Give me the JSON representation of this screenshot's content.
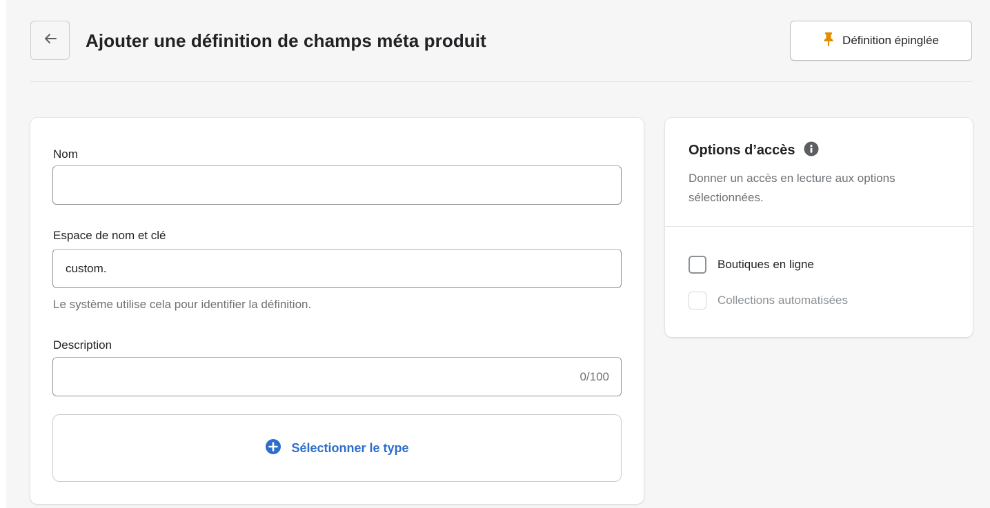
{
  "header": {
    "back_icon": "arrow-left-icon",
    "title": "Ajouter une définition de champs méta produit",
    "pin_button": {
      "label": "Définition épinglée",
      "icon": "pin-icon",
      "icon_color": "#e28d00"
    }
  },
  "form": {
    "name": {
      "label": "Nom",
      "value": "",
      "placeholder": ""
    },
    "namespace": {
      "label": "Espace de nom et clé",
      "value": "custom.",
      "help": "Le système utilise cela pour identifier la définition."
    },
    "description": {
      "label": "Description",
      "value": "",
      "counter": "0/100"
    },
    "select_type": {
      "label": "Sélectionner le type",
      "icon": "plus-circle-icon",
      "color": "#2c6ecb"
    }
  },
  "access": {
    "title": "Options d’accès",
    "info_icon": "info-icon",
    "description": "Donner un accès en lecture aux options sélectionnées.",
    "options": [
      {
        "label": "Boutiques en ligne",
        "checked": false,
        "disabled": false
      },
      {
        "label": "Collections automatisées",
        "checked": false,
        "disabled": true
      }
    ]
  },
  "colors": {
    "background": "#f6f6f7",
    "card": "#ffffff",
    "link": "#2c6ecb",
    "pin": "#e28d00"
  }
}
